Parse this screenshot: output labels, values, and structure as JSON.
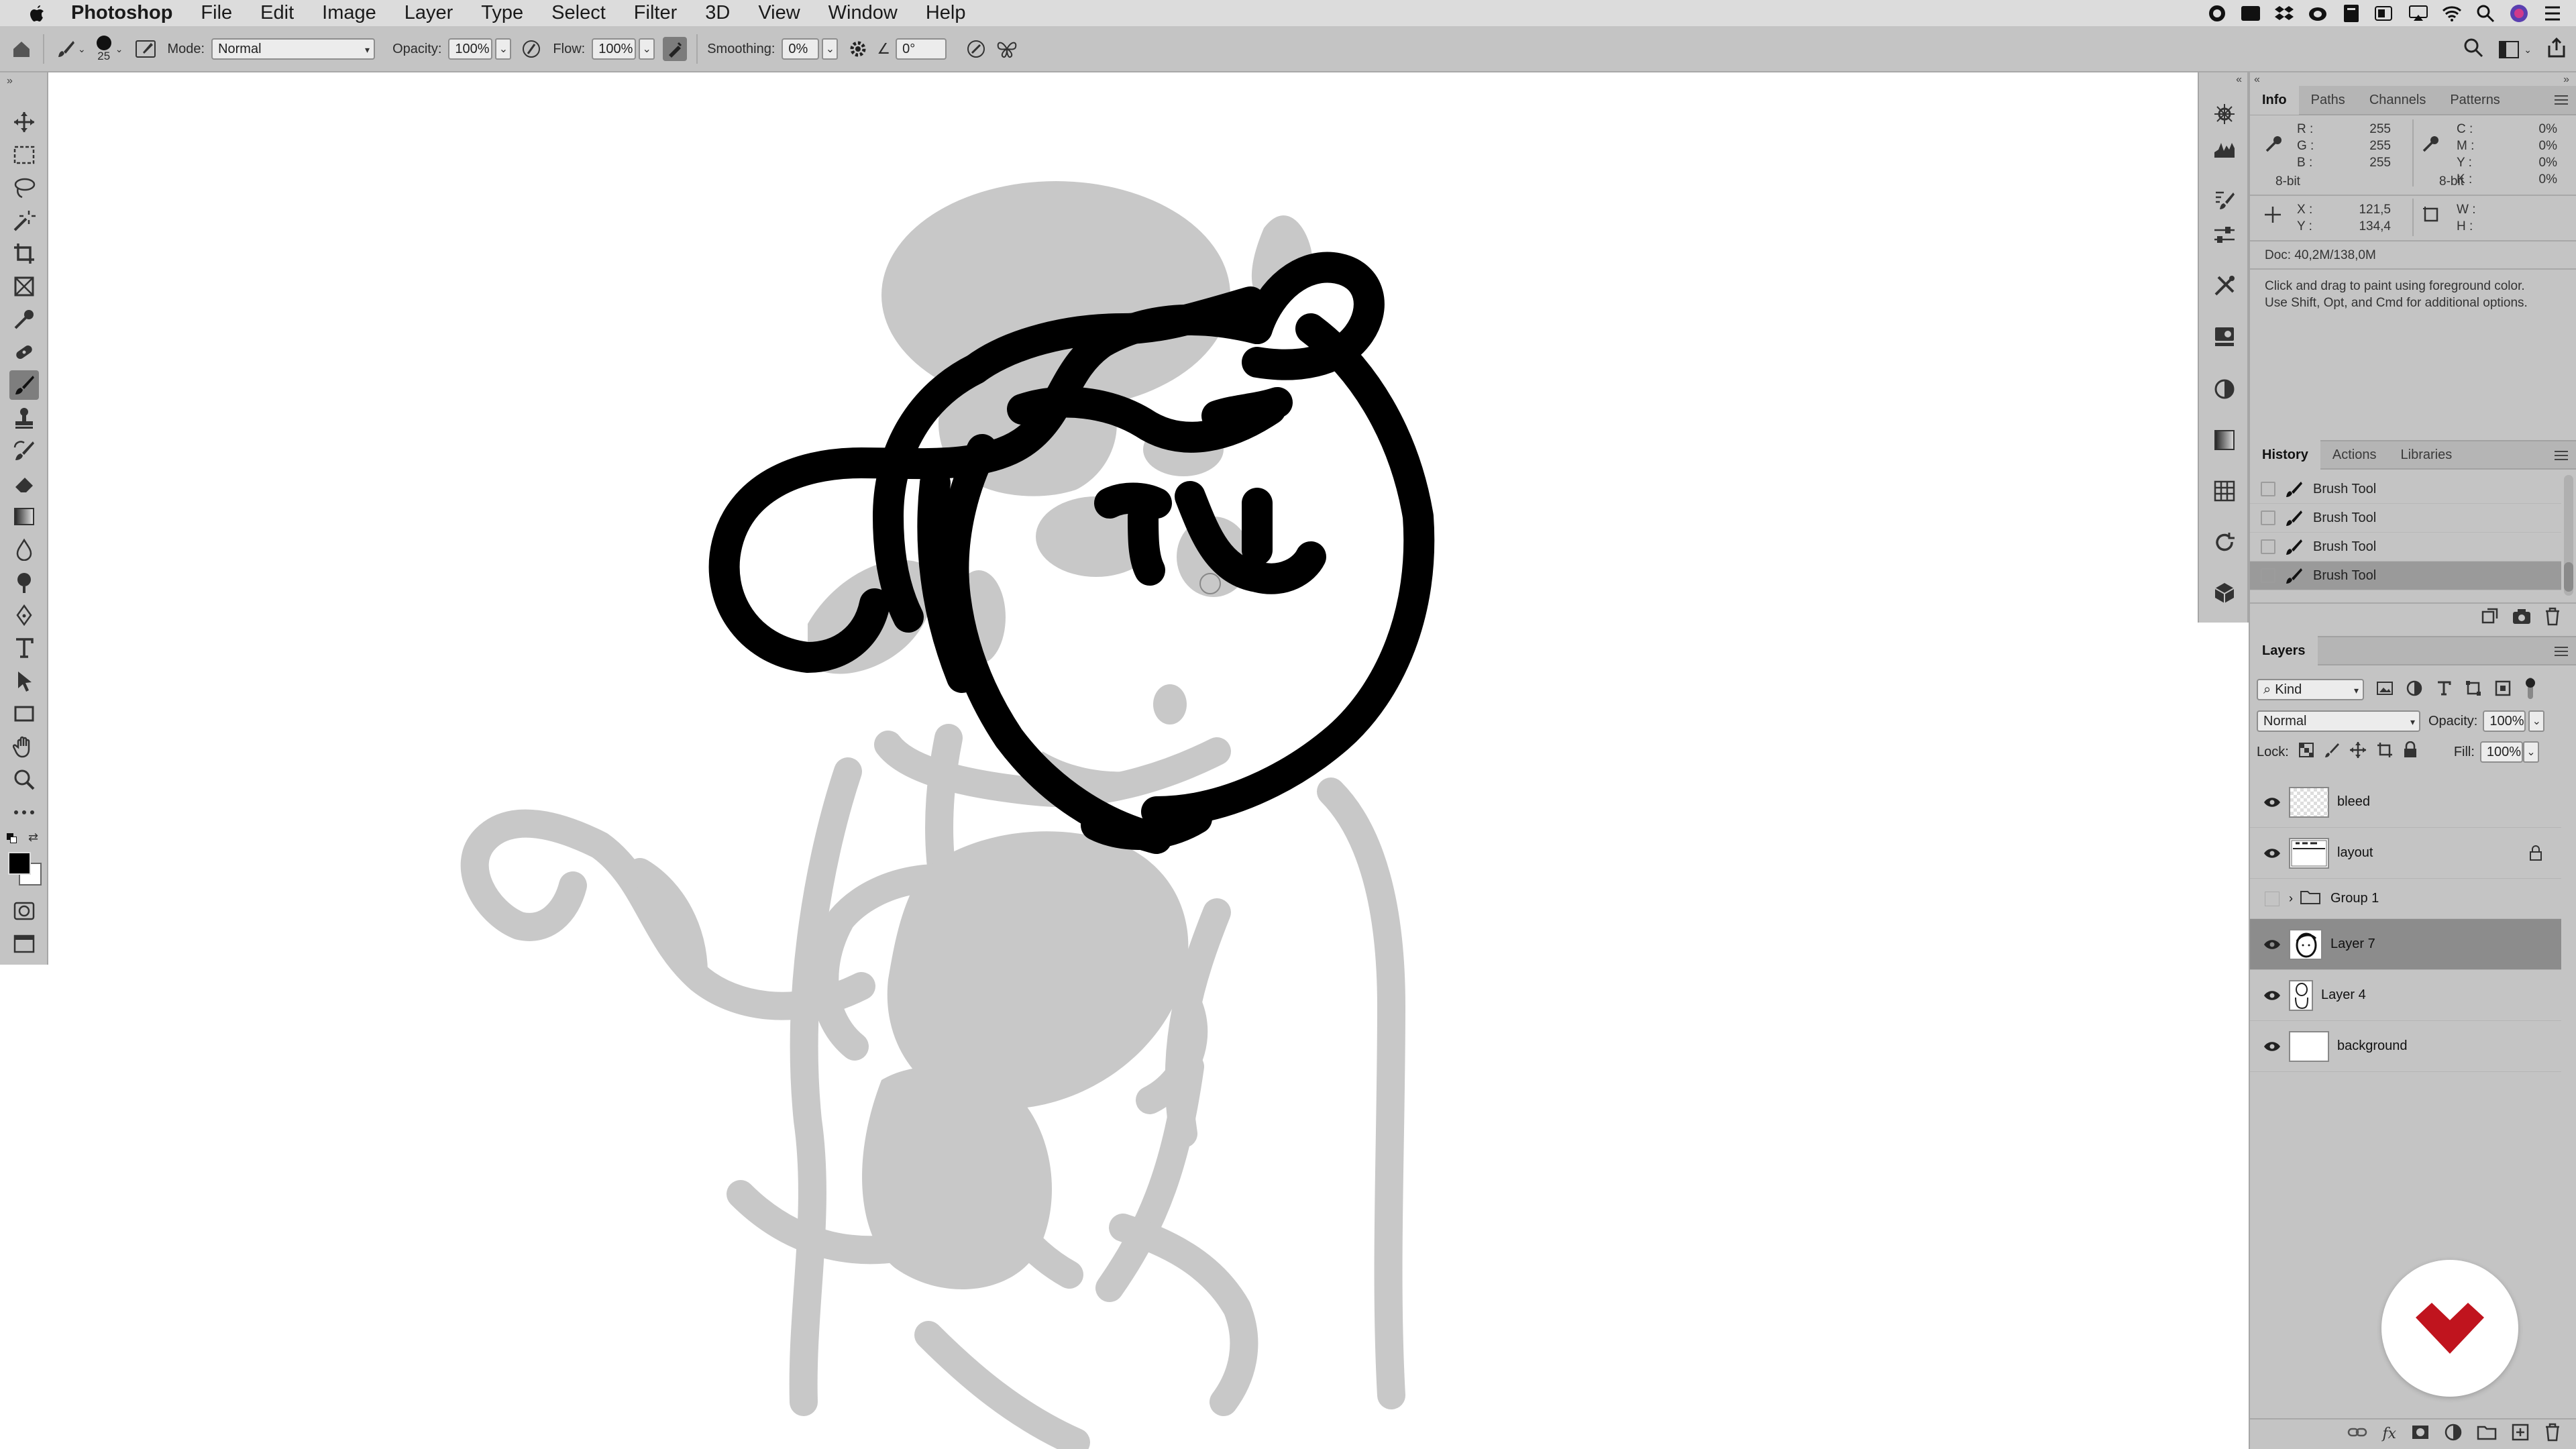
{
  "menubar": {
    "app_name": "Photoshop",
    "items": [
      "File",
      "Edit",
      "Image",
      "Layer",
      "Type",
      "Select",
      "Filter",
      "3D",
      "View",
      "Window",
      "Help"
    ]
  },
  "options_bar": {
    "brush_size": "25",
    "mode_label": "Mode:",
    "mode_value": "Normal",
    "opacity_label": "Opacity:",
    "opacity_value": "100%",
    "flow_label": "Flow:",
    "flow_value": "100%",
    "smoothing_label": "Smoothing:",
    "smoothing_value": "0%",
    "angle_value": "0°"
  },
  "info_panel": {
    "tabs": [
      "Info",
      "Paths",
      "Channels",
      "Patterns"
    ],
    "rgb": {
      "R": "255",
      "G": "255",
      "B": "255"
    },
    "cmyk": {
      "C": "0%",
      "M": "0%",
      "Y": "0%",
      "K": "0%"
    },
    "bit_left": "8-bit",
    "bit_right": "8-bit",
    "x_label": "X :",
    "y_label": "Y :",
    "x_value": "121,5",
    "y_value": "134,4",
    "w_label": "W :",
    "h_label": "H :",
    "doc": "Doc: 40,2M/138,0M",
    "hint_line1": "Click and drag to paint using foreground color.",
    "hint_line2": "Use Shift, Opt, and Cmd for additional options."
  },
  "history_panel": {
    "tabs": [
      "History",
      "Actions",
      "Libraries"
    ],
    "items": [
      "Brush Tool",
      "Brush Tool",
      "Brush Tool",
      "Brush Tool"
    ],
    "selected_index": 3
  },
  "layers_panel": {
    "title": "Layers",
    "kind_filter": "Kind",
    "blend_mode": "Normal",
    "opacity_label": "Opacity:",
    "opacity_value": "100%",
    "lock_label": "Lock:",
    "fill_label": "Fill:",
    "fill_value": "100%",
    "layers": [
      {
        "name": "bleed",
        "visible": true,
        "locked": false,
        "type": "pixel"
      },
      {
        "name": "layout",
        "visible": true,
        "locked": true,
        "type": "pixel"
      },
      {
        "name": "Group 1",
        "visible": false,
        "locked": false,
        "type": "group"
      },
      {
        "name": "Layer 7",
        "visible": true,
        "locked": false,
        "type": "pixel",
        "selected": true
      },
      {
        "name": "Layer 4",
        "visible": true,
        "locked": false,
        "type": "pixel"
      },
      {
        "name": "background",
        "visible": true,
        "locked": false,
        "type": "pixel"
      }
    ]
  },
  "colors": {
    "ui_gray": "#c4c4c4",
    "ink": "#000000",
    "sketch": "#c8c8c8",
    "logo_red": "#c0141e"
  }
}
